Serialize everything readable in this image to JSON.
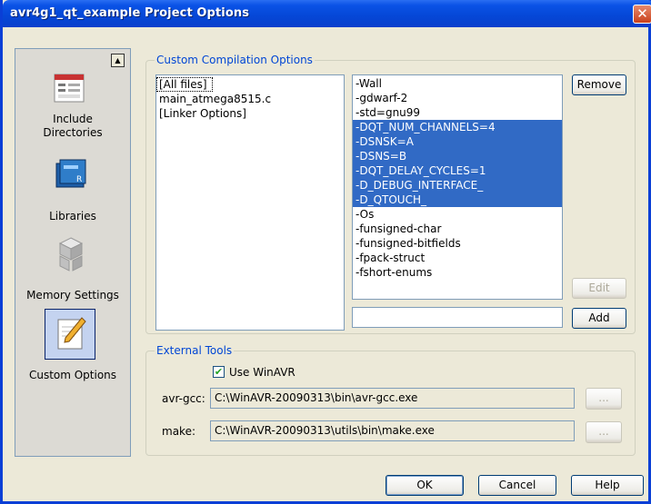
{
  "window": {
    "title": "avr4g1_qt_example Project Options",
    "close_glyph": "✕"
  },
  "sidebar": {
    "scroll_glyph": "▲",
    "items": [
      {
        "label": "Include\nDirectories",
        "icon": "include-directories-icon"
      },
      {
        "label": "Libraries",
        "icon": "libraries-icon"
      },
      {
        "label": "Memory Settings",
        "icon": "memory-settings-icon"
      },
      {
        "label": "Custom Options",
        "icon": "custom-options-icon",
        "selected": true
      }
    ]
  },
  "custom_compilation": {
    "group_title": "Custom Compilation Options",
    "files": [
      "[All files]",
      "main_atmega8515.c",
      "[Linker Options]"
    ],
    "options": [
      {
        "text": "-Wall",
        "selected": false
      },
      {
        "text": "-gdwarf-2",
        "selected": false
      },
      {
        "text": "-std=gnu99",
        "selected": false
      },
      {
        "text": "-DQT_NUM_CHANNELS=4",
        "selected": true
      },
      {
        "text": "-DSNSK=A",
        "selected": true
      },
      {
        "text": "-DSNS=B",
        "selected": true
      },
      {
        "text": "-DQT_DELAY_CYCLES=1",
        "selected": true
      },
      {
        "text": "-D_DEBUG_INTERFACE_",
        "selected": true
      },
      {
        "text": "-D_QTOUCH_",
        "selected": true
      },
      {
        "text": "-Os",
        "selected": false
      },
      {
        "text": "-funsigned-char",
        "selected": false
      },
      {
        "text": "-funsigned-bitfields",
        "selected": false
      },
      {
        "text": "-fpack-struct",
        "selected": false
      },
      {
        "text": "-fshort-enums",
        "selected": false
      }
    ],
    "remove_label": "Remove",
    "edit_label": "Edit",
    "add_label": "Add",
    "new_option_value": ""
  },
  "external_tools": {
    "group_title": "External Tools",
    "use_winavr_label": "Use WinAVR",
    "use_winavr_checked": true,
    "check_glyph": "✔",
    "avr_gcc_label": "avr-gcc:",
    "avr_gcc_path": "C:\\WinAVR-20090313\\bin\\avr-gcc.exe",
    "make_label": "make:",
    "make_path": "C:\\WinAVR-20090313\\utils\\bin\\make.exe",
    "browse_label": "..."
  },
  "footer": {
    "ok_label": "OK",
    "cancel_label": "Cancel",
    "help_label": "Help"
  },
  "colors": {
    "titlebar": "#0a52e6",
    "selection": "#316ac5",
    "group_title": "#0046d5"
  }
}
